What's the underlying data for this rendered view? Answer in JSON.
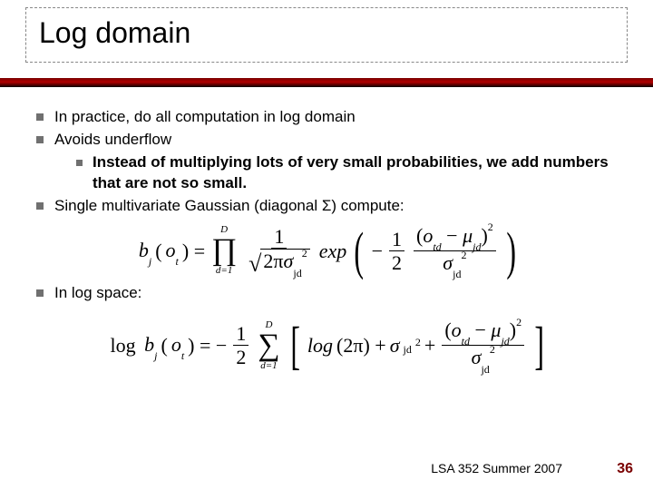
{
  "title": "Log domain",
  "bullets": {
    "b1": "In practice, do all computation in log domain",
    "b2": "Avoids underflow",
    "b2a": "Instead of multiplying lots of very small probabilities, we add numbers that are not so small.",
    "b3": "Single multivariate Gaussian (diagonal Σ) compute:",
    "b4": "In log space:"
  },
  "equations": {
    "eq1": "b_j(o_t) = \\prod_{d=1}^{D} \\frac{1}{\\sqrt{2\\pi\\sigma_{jd}^2}} exp\\left(-\\frac{1}{2} \\frac{(o_{td} - \\mu_{jd})^2}{\\sigma_{jd}^2}\\right)",
    "eq2": "\\log b_j(o_t) = -\\frac{1}{2} \\sum_{d=1}^{D} \\left[ log(2\\pi) + \\sigma_{jd}^2 + \\frac{(o_{td} - \\mu_{jd})^2}{\\sigma_{jd}^2} \\right]"
  },
  "footer": "LSA 352 Summer 2007",
  "page": "36"
}
